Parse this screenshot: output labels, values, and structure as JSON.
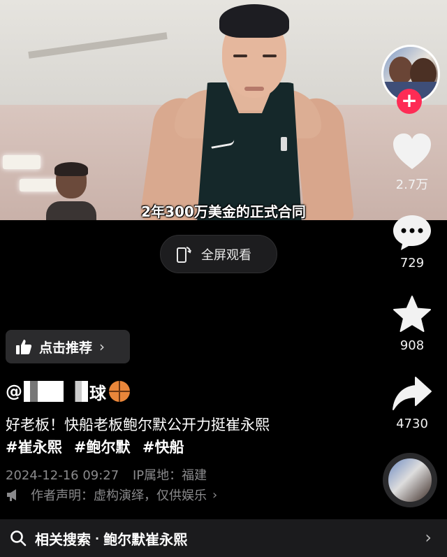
{
  "video": {
    "subtitle": "2年300万美金的正式合同"
  },
  "fullscreen": {
    "label": "全屏观看"
  },
  "rail": {
    "like_count": "2.7万",
    "comment_count": "729",
    "favorite_count": "908",
    "share_count": "4730",
    "follow_symbol": "+"
  },
  "recommend": {
    "label": "点击推荐",
    "chevron": "›"
  },
  "post": {
    "author_prefix": "@",
    "author_mid": "",
    "author_suffix": "球",
    "description": "好老板！快船老板鲍尔默公开力挺崔永熙",
    "tags": [
      "#崔永熙",
      "#鲍尔默",
      "#快船"
    ],
    "date": "2024-12-16 09:27",
    "ip_location": "IP属地：福建",
    "statement": "作者声明：虚构演绎，仅供娱乐",
    "statement_chevron": "›"
  },
  "search": {
    "prefix": "相关搜索",
    "dot": "·",
    "query": "鲍尔默崔永熙",
    "chevron": "›"
  },
  "colors": {
    "background": "#000000",
    "follow_badge": "#fe2c55",
    "pill_bg": "#1d1d1f",
    "meta_text": "#8a8a8c"
  }
}
